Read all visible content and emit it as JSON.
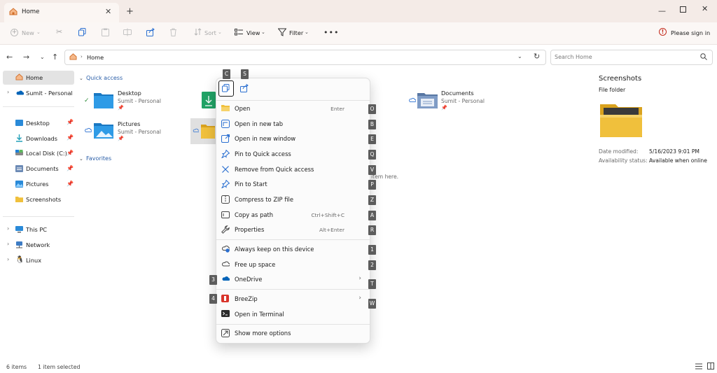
{
  "tab": {
    "title": "Home"
  },
  "toolbar": {
    "new_label": "New",
    "sort_label": "Sort",
    "view_label": "View",
    "filter_label": "Filter",
    "signin_label": "Please sign in"
  },
  "address": {
    "crumb": "Home",
    "search_placeholder": "Search Home"
  },
  "sidebar": {
    "home": "Home",
    "onedrive": "Sumit - Personal",
    "pinned": [
      {
        "label": "Desktop",
        "icon": "desktop-icon"
      },
      {
        "label": "Downloads",
        "icon": "downloads-icon"
      },
      {
        "label": "Local Disk (C:)",
        "icon": "drive-icon"
      },
      {
        "label": "Documents",
        "icon": "documents-icon"
      },
      {
        "label": "Pictures",
        "icon": "pictures-icon"
      },
      {
        "label": "Screenshots",
        "icon": "folder-icon"
      }
    ],
    "groups": [
      {
        "label": "This PC",
        "icon": "pc-icon"
      },
      {
        "label": "Network",
        "icon": "network-icon"
      },
      {
        "label": "Linux",
        "icon": "linux-icon"
      }
    ]
  },
  "content": {
    "quick_access": "Quick access",
    "favorites": "Favorites",
    "desktop": {
      "name": "Desktop",
      "sub": "Sumit - Personal"
    },
    "pictures": {
      "name": "Pictures",
      "sub": "Sumit - Personal"
    },
    "documents": {
      "name": "Documents",
      "sub": "Sumit - Personal"
    },
    "empty_hint": "item here."
  },
  "context_menu": {
    "quick_keys": [
      "C",
      "S"
    ],
    "items": [
      {
        "label": "Open",
        "shortcut": "Enter",
        "key": "O",
        "icon": "open-folder-icon"
      },
      {
        "label": "Open in new tab",
        "shortcut": "",
        "key": "B",
        "icon": "new-tab-icon"
      },
      {
        "label": "Open in new window",
        "shortcut": "",
        "key": "E",
        "icon": "new-window-icon"
      },
      {
        "label": "Pin to Quick access",
        "shortcut": "",
        "key": "Q",
        "icon": "pin-icon"
      },
      {
        "label": "Remove from Quick access",
        "shortcut": "",
        "key": "V",
        "icon": "remove-icon"
      },
      {
        "label": "Pin to Start",
        "shortcut": "",
        "key": "P",
        "icon": "pin-start-icon"
      },
      {
        "label": "Compress to ZIP file",
        "shortcut": "",
        "key": "Z",
        "icon": "zip-icon"
      },
      {
        "label": "Copy as path",
        "shortcut": "Ctrl+Shift+C",
        "key": "A",
        "icon": "copy-path-icon"
      },
      {
        "label": "Properties",
        "shortcut": "Alt+Enter",
        "key": "R",
        "icon": "properties-icon"
      },
      {
        "label": "Always keep on this device",
        "shortcut": "",
        "key": "1",
        "icon": "keep-device-icon"
      },
      {
        "label": "Free up space",
        "shortcut": "",
        "key": "2",
        "icon": "cloud-icon"
      },
      {
        "label": "OneDrive",
        "shortcut": "",
        "key": "T",
        "left_key": "3",
        "icon": "onedrive-icon"
      },
      {
        "label": "BreeZip",
        "shortcut": "",
        "key": "W",
        "left_key": "4",
        "icon": "breezip-icon"
      },
      {
        "label": "Open in Terminal",
        "shortcut": "",
        "key": "",
        "icon": "terminal-icon"
      },
      {
        "label": "Show more options",
        "shortcut": "",
        "key": "",
        "icon": "more-options-icon"
      }
    ]
  },
  "details": {
    "title": "Screenshots",
    "type": "File folder",
    "modified_label": "Date modified:",
    "modified_value": "5/16/2023 9:01 PM",
    "availability_label": "Availability status:",
    "availability_value": "Available when online"
  },
  "status": {
    "count": "6 items",
    "selected": "1 item selected"
  },
  "colors": {
    "accent": "#0067c0",
    "folder_yellow": "#f0c03c",
    "signin_red": "#c42b1c"
  }
}
